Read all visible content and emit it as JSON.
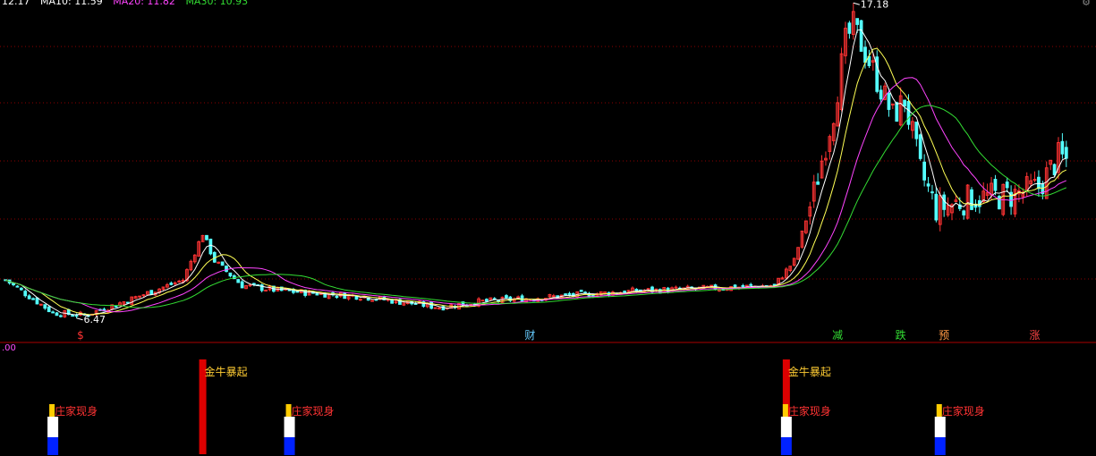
{
  "header": {
    "items": [
      {
        "text": "12.17",
        "color": "#ffffff"
      },
      {
        "text": "MA10: 11.59",
        "color": "#ffffff"
      },
      {
        "text": "MA20: 11.82",
        "color": "#ff44ff"
      },
      {
        "text": "MA30: 10.93",
        "color": "#33dd33"
      }
    ]
  },
  "indicator": {
    "value_label": ".00"
  },
  "settings_icon": "gear-icon",
  "colors": {
    "up": "#ff3333",
    "down": "#54ffff",
    "ma5": "#ffffff",
    "ma10": "#ffff55",
    "ma20": "#ff44ff",
    "ma30": "#33dd33",
    "grid": "#8b0000",
    "divider": "#aa0000"
  },
  "chart_data": {
    "type": "candlestick",
    "series": [
      {
        "name": "MA5"
      },
      {
        "name": "MA10"
      },
      {
        "name": "MA20"
      },
      {
        "name": "MA30"
      }
    ],
    "annotations": {
      "high": {
        "label": "17.18",
        "value": 17.18
      },
      "low": {
        "label": "6.47",
        "value": 6.47
      }
    },
    "markers": [
      {
        "text": "$",
        "color": "#ff3333",
        "bar": 19
      },
      {
        "text": "财",
        "color": "#66ccff",
        "bar": 133
      },
      {
        "text": "减",
        "color": "#33dd33",
        "bar": 211
      },
      {
        "text": "跌",
        "color": "#33dd33",
        "bar": 227
      },
      {
        "text": "预",
        "color": "#ff9944",
        "bar": 238
      },
      {
        "text": "涨",
        "color": "#ff4444",
        "bar": 261
      }
    ],
    "signals": [
      {
        "type": "jinniu",
        "label": "金牛暴起",
        "bar": 50
      },
      {
        "type": "jinniu",
        "label": "金牛暴起",
        "bar": 198
      },
      {
        "type": "zhuangjia",
        "label": "庄家现身",
        "bar": 12
      },
      {
        "type": "zhuangjia",
        "label": "庄家现身",
        "bar": 72
      },
      {
        "type": "zhuangjia",
        "label": "庄家现身",
        "bar": 198
      },
      {
        "type": "zhuangjia",
        "label": "庄家现身",
        "bar": 237
      }
    ]
  }
}
